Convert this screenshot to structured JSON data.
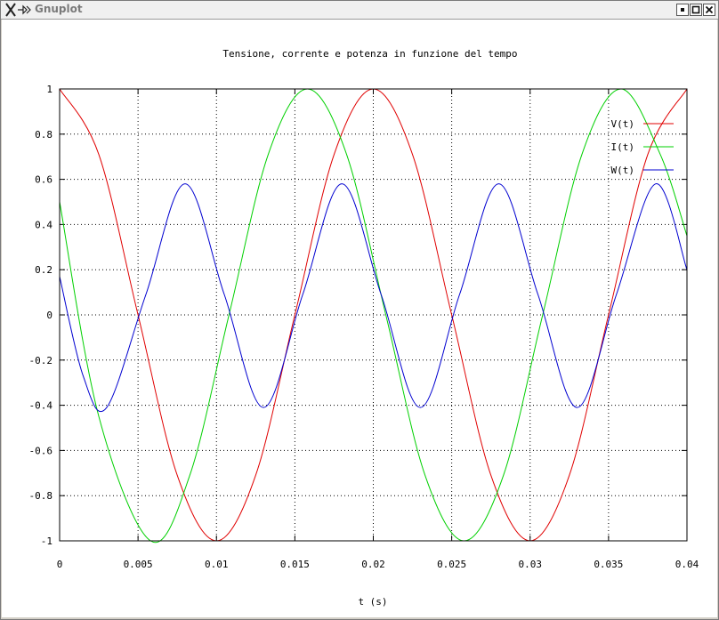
{
  "window": {
    "title": "Gnuplot"
  },
  "chart_data": {
    "type": "line",
    "title": "Tensione, corrente e potenza in funzione del tempo",
    "xlabel": "t (s)",
    "ylabel": "",
    "xlim": [
      0,
      0.04
    ],
    "ylim": [
      -1,
      1
    ],
    "grid": true,
    "legend_position": "top-right",
    "x_ticks": [
      "0",
      "0.005",
      "0.01",
      "0.015",
      "0.02",
      "0.025",
      "0.03",
      "0.035",
      "0.04"
    ],
    "y_ticks": [
      "1",
      "0.8",
      "0.6",
      "0.4",
      "0.2",
      "0",
      "-0.2",
      "-0.4",
      "-0.6",
      "-0.8",
      "-1"
    ],
    "series": [
      {
        "name": "V(t)",
        "color": "#e00000",
        "x": [
          0,
          0.0025,
          0.005,
          0.0075,
          0.01,
          0.0125,
          0.015,
          0.0175,
          0.02,
          0.0225,
          0.025,
          0.0275,
          0.03,
          0.0325,
          0.035,
          0.0375,
          0.04
        ],
        "values": [
          1,
          0.71,
          0,
          -0.71,
          -1,
          -0.71,
          0,
          0.71,
          1,
          0.71,
          0,
          -0.71,
          -1,
          -0.71,
          0,
          0.71,
          1
        ]
      },
      {
        "name": "I(t)",
        "color": "#00d000",
        "x": [
          0,
          0.0025,
          0.0058,
          0.0083,
          0.0108,
          0.0133,
          0.0158,
          0.0183,
          0.0208,
          0.0233,
          0.0258,
          0.0283,
          0.0308,
          0.0333,
          0.0358,
          0.0383,
          0.04
        ],
        "values": [
          0.5,
          -0.45,
          -1,
          -0.71,
          0,
          0.71,
          1,
          0.71,
          0,
          -0.71,
          -1,
          -0.71,
          0,
          0.71,
          1,
          0.71,
          0.35
        ]
      },
      {
        "name": "W(t)",
        "color": "#0000d0",
        "x": [
          0,
          0.0015,
          0.003,
          0.0055,
          0.008,
          0.0105,
          0.013,
          0.0155,
          0.018,
          0.0205,
          0.023,
          0.0255,
          0.028,
          0.0305,
          0.033,
          0.0355,
          0.038,
          0.04
        ],
        "values": [
          0.17,
          -0.27,
          -0.41,
          0.09,
          0.58,
          0.09,
          -0.41,
          0.09,
          0.58,
          0.09,
          -0.41,
          0.09,
          0.58,
          0.09,
          -0.41,
          0.09,
          0.58,
          0.2
        ]
      }
    ]
  }
}
